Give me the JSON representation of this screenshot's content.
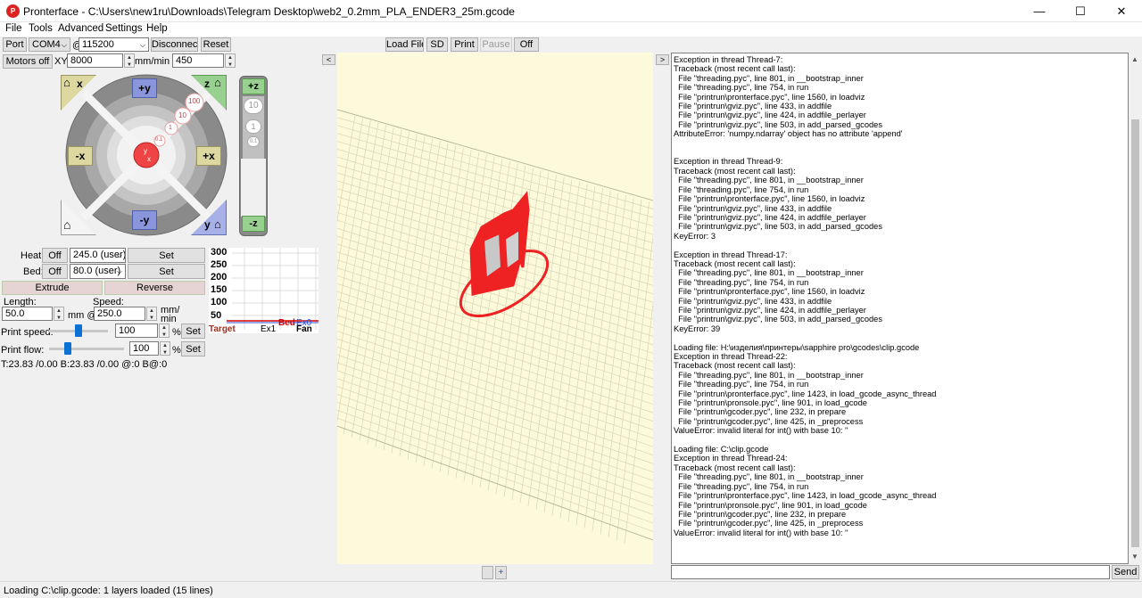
{
  "window": {
    "title": "Pronterface - C:\\Users\\new1ru\\Downloads\\Telegram Desktop\\web2_0.2mm_PLA_ENDER3_25m.gcode",
    "minimize": "—",
    "maximize": "☐",
    "close": "✕",
    "app_icon": "P"
  },
  "menu": [
    "File",
    "Tools",
    "Advanced",
    "Settings",
    "Help"
  ],
  "connection": {
    "port_label": "Port",
    "port_value": "COM4",
    "at": "@",
    "baud_value": "115200",
    "disconnect": "Disconnect",
    "reset": "Reset"
  },
  "printbar": {
    "load_file": "Load File",
    "sd": "SD",
    "print": "Print",
    "pause": "Pause",
    "off": "Off"
  },
  "motion": {
    "motors_off": "Motors off",
    "xy_label": "XY:",
    "xy_value": "8000",
    "xy_unit": "mm/min Z:",
    "z_value": "450"
  },
  "jog": {
    "home_x": "x",
    "home_y": "y",
    "home_z": "z",
    "home_all": "",
    "plus_y": "+y",
    "minus_y": "-y",
    "plus_x": "+x",
    "minus_x": "-x",
    "step_100": "100",
    "step_10": "10",
    "step_1": "1",
    "step_01": "0.1",
    "center_y": "y",
    "center_x": "x",
    "plus_z": "+z",
    "minus_z": "-z",
    "z10": "10",
    "z1": "1",
    "z01": "0.1"
  },
  "temps": {
    "heat_label": "Heat:",
    "heat_off": "Off",
    "heat_value": "245.0 (user)",
    "heat_set": "Set",
    "bed_label": "Bed:",
    "bed_off": "Off",
    "bed_value": "80.0 (user)",
    "bed_set": "Set"
  },
  "graph": {
    "yticks": [
      "300",
      "250",
      "200",
      "150",
      "100",
      "50"
    ],
    "labels": [
      "Target",
      "Ex1",
      "Bed",
      "Ex0",
      "Fan"
    ],
    "label_colors": [
      "#a03020",
      "#000000",
      "#d00000",
      "#3050d0",
      "#000000"
    ]
  },
  "extrude": {
    "extrude": "Extrude",
    "reverse": "Reverse",
    "length_label": "Length:",
    "speed_label": "Speed:",
    "length_value": "50.0",
    "length_unit": "mm @",
    "speed_value": "250.0",
    "speed_unit": "mm/\nmin"
  },
  "factors": {
    "print_speed_label": "Print speed:",
    "print_speed_value": "100",
    "print_speed_fraction": 0.5,
    "print_flow_label": "Print flow:",
    "print_flow_value": "100",
    "print_flow_fraction": 0.25,
    "percent": "%",
    "set": "Set"
  },
  "temp_status": "T:23.83 /0.00 B:23.83 /0.00 @:0 B@:0",
  "viewport": {
    "collapse_left": "<",
    "expand_right": ">",
    "minus": "",
    "plus": "+",
    "bg": "#fcfadb",
    "model_color": "#ee2222"
  },
  "console": {
    "lines": [
      "Exception in thread Thread-7:",
      "Traceback (most recent call last):",
      "  File \"threading.pyc\", line 801, in __bootstrap_inner",
      "  File \"threading.pyc\", line 754, in run",
      "  File \"printrun\\pronterface.pyc\", line 1560, in loadviz",
      "  File \"printrun\\gviz.pyc\", line 433, in addfile",
      "  File \"printrun\\gviz.pyc\", line 424, in addfile_perlayer",
      "  File \"printrun\\gviz.pyc\", line 503, in add_parsed_gcodes",
      "AttributeError: 'numpy.ndarray' object has no attribute 'append'",
      "",
      "",
      "Exception in thread Thread-9:",
      "Traceback (most recent call last):",
      "  File \"threading.pyc\", line 801, in __bootstrap_inner",
      "  File \"threading.pyc\", line 754, in run",
      "  File \"printrun\\pronterface.pyc\", line 1560, in loadviz",
      "  File \"printrun\\gviz.pyc\", line 433, in addfile",
      "  File \"printrun\\gviz.pyc\", line 424, in addfile_perlayer",
      "  File \"printrun\\gviz.pyc\", line 503, in add_parsed_gcodes",
      "KeyError: 3",
      "",
      "Exception in thread Thread-17:",
      "Traceback (most recent call last):",
      "  File \"threading.pyc\", line 801, in __bootstrap_inner",
      "  File \"threading.pyc\", line 754, in run",
      "  File \"printrun\\pronterface.pyc\", line 1560, in loadviz",
      "  File \"printrun\\gviz.pyc\", line 433, in addfile",
      "  File \"printrun\\gviz.pyc\", line 424, in addfile_perlayer",
      "  File \"printrun\\gviz.pyc\", line 503, in add_parsed_gcodes",
      "KeyError: 39",
      "",
      "Loading file: H:\\изделия\\принтеры\\sapphire pro\\gcodes\\clip.gcode",
      "Exception in thread Thread-22:",
      "Traceback (most recent call last):",
      "  File \"threading.pyc\", line 801, in __bootstrap_inner",
      "  File \"threading.pyc\", line 754, in run",
      "  File \"printrun\\pronterface.pyc\", line 1423, in load_gcode_async_thread",
      "  File \"printrun\\pronsole.pyc\", line 901, in load_gcode",
      "  File \"printrun\\gcoder.pyc\", line 232, in prepare",
      "  File \"printrun\\gcoder.pyc\", line 425, in _preprocess",
      "ValueError: invalid literal for int() with base 10: ''",
      "",
      "Loading file: C:\\clip.gcode",
      "Exception in thread Thread-24:",
      "Traceback (most recent call last):",
      "  File \"threading.pyc\", line 801, in __bootstrap_inner",
      "  File \"threading.pyc\", line 754, in run",
      "  File \"printrun\\pronterface.pyc\", line 1423, in load_gcode_async_thread",
      "  File \"printrun\\pronsole.pyc\", line 901, in load_gcode",
      "  File \"printrun\\gcoder.pyc\", line 232, in prepare",
      "  File \"printrun\\gcoder.pyc\", line 425, in _preprocess",
      "ValueError: invalid literal for int() with base 10: ''"
    ],
    "input_value": "",
    "send": "Send"
  },
  "status": "Loading C:\\clip.gcode: 1 layers loaded (15 lines)"
}
